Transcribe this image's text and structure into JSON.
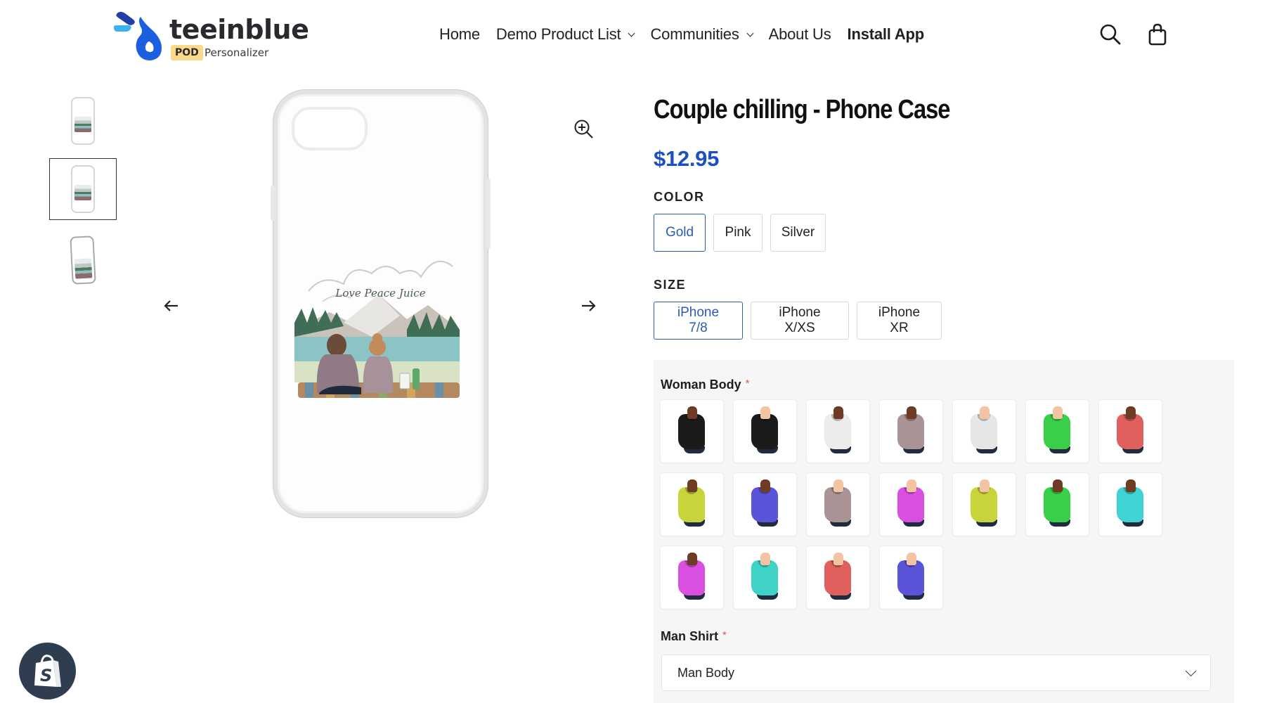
{
  "brand": {
    "name": "teeinblue",
    "badge": "POD",
    "tagline": "Personalizer",
    "colors": {
      "drop": "#1a5fe0",
      "dash": "#3db2f0",
      "navy": "#1e3fa8",
      "badge_bg": "#fcd98a"
    }
  },
  "nav": {
    "items": [
      {
        "label": "Home",
        "dropdown": false,
        "bold": false
      },
      {
        "label": "Demo Product List",
        "dropdown": true,
        "bold": false
      },
      {
        "label": "Communities",
        "dropdown": true,
        "bold": false
      },
      {
        "label": "About Us",
        "dropdown": false,
        "bold": false
      },
      {
        "label": "Install App",
        "dropdown": false,
        "bold": true
      }
    ],
    "icons": [
      "search-icon",
      "shopping-bag-icon"
    ]
  },
  "gallery": {
    "thumbnails": [
      {
        "name": "Front view",
        "selected": false
      },
      {
        "name": "Front view alt",
        "selected": true
      },
      {
        "name": "Angled view",
        "selected": false
      }
    ],
    "main_image_caption": "Love Peace Juice",
    "controls": [
      "zoom-in-icon",
      "arrow-left-icon",
      "arrow-right-icon"
    ]
  },
  "product": {
    "title": "Couple chilling - Phone Case",
    "price": "$12.95",
    "price_color": "#1d4fc4",
    "accent_color": "#2a5db0",
    "options": [
      {
        "label": "COLOR",
        "values": [
          "Gold",
          "Pink",
          "Silver"
        ],
        "selected": "Gold"
      },
      {
        "label": "SIZE",
        "values": [
          "iPhone 7/8",
          "iPhone X/XS",
          "iPhone XR"
        ],
        "selected": "iPhone 7/8"
      }
    ]
  },
  "personalize": {
    "woman_body": {
      "label": "Woman Body",
      "required_mark": "*",
      "swatches": [
        {
          "shirt": "#1b1b1b",
          "skin": "#6e3b24"
        },
        {
          "shirt": "#1b1b1b",
          "skin": "#f3c4a4"
        },
        {
          "shirt": "#ececec",
          "skin": "#6e3b24"
        },
        {
          "shirt": "#a99394",
          "skin": "#6e3b24"
        },
        {
          "shirt": "#e6e6e6",
          "skin": "#f3c4a4"
        },
        {
          "shirt": "#39cf48",
          "skin": "#f3c4a4"
        },
        {
          "shirt": "#e0605d",
          "skin": "#6e3b24"
        },
        {
          "shirt": "#c9d33a",
          "skin": "#6e3b24"
        },
        {
          "shirt": "#5a54d8",
          "skin": "#6e3b24"
        },
        {
          "shirt": "#a99394",
          "skin": "#f3c4a4"
        },
        {
          "shirt": "#d94fe0",
          "skin": "#f3c4a4"
        },
        {
          "shirt": "#c9d33a",
          "skin": "#f3c4a4"
        },
        {
          "shirt": "#39cf48",
          "skin": "#6e3b24"
        },
        {
          "shirt": "#3fd3d6",
          "skin": "#6e3b24"
        },
        {
          "shirt": "#d94fe0",
          "skin": "#6e3b24"
        },
        {
          "shirt": "#3fd3c8",
          "skin": "#f3c4a4"
        },
        {
          "shirt": "#e0605d",
          "skin": "#f3c4a4"
        },
        {
          "shirt": "#5a54d8",
          "skin": "#f3c4a4"
        }
      ]
    },
    "man_shirt": {
      "label": "Man Shirt",
      "required_mark": "*",
      "selected": "Man Body"
    }
  },
  "floating": {
    "shopify_button": "shopify-bag-icon"
  }
}
